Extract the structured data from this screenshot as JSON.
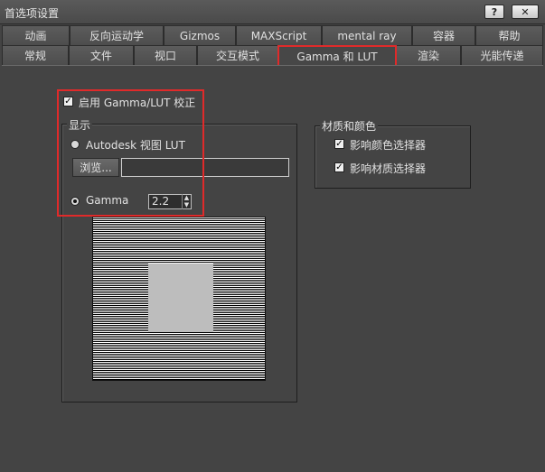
{
  "window": {
    "title": "首选项设置",
    "help_label": "?",
    "close_label": "✕"
  },
  "tabs_row1": [
    "动画",
    "反向运动学",
    "Gizmos",
    "MAXScript",
    "mental ray",
    "容器",
    "帮助"
  ],
  "tabs_row2": [
    "常规",
    "文件",
    "视口",
    "交互模式",
    "Gamma 和 LUT",
    "渲染",
    "光能传递"
  ],
  "active_tab": "Gamma 和 LUT",
  "gamma_panel": {
    "enable_label": "启用 Gamma/LUT 校正",
    "enable_checked": true,
    "display_group": "显示",
    "lut_radio_label": "Autodesk 视图 LUT",
    "browse_label": "浏览...",
    "lut_path": "",
    "gamma_radio_label": "Gamma",
    "gamma_value": "2.2"
  },
  "material_group": {
    "title": "材质和颜色",
    "affect_color_selector": "影响颜色选择器",
    "affect_material_selector": "影响材质选择器",
    "color_checked": true,
    "material_checked": true
  },
  "highlight_color": "#e02a2a"
}
